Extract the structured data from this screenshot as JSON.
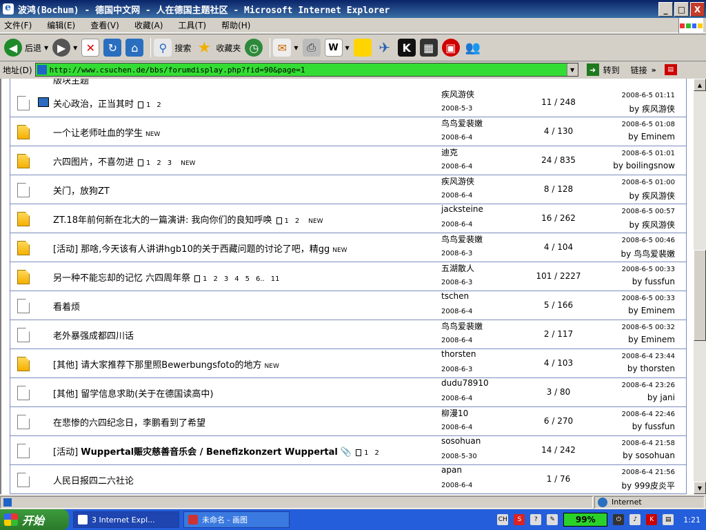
{
  "window": {
    "title": "波鸿(Bochum) - 德国中文网 - 人在德国主题社区 - Microsoft Internet Explorer",
    "btn_min": "_",
    "btn_max": "□",
    "btn_close": "X"
  },
  "menu": [
    "文件(F)",
    "编辑(E)",
    "查看(V)",
    "收藏(A)",
    "工具(T)",
    "帮助(H)"
  ],
  "toolbar": {
    "back": "后退",
    "search": "搜索",
    "favorites": "收藏夹"
  },
  "address": {
    "label": "地址(D)",
    "url": "http://www.csuchen.de/bbs/forumdisplay.php?fid=90&page=1",
    "go": "转到",
    "links": "链接",
    "chevron": "»"
  },
  "partial_row_text": "版块主题",
  "threads": [
    {
      "icon": "plain",
      "picture": true,
      "prefix": "",
      "title": "关心政治，正当其时",
      "bold": false,
      "pages": [
        "1",
        "2"
      ],
      "new": "",
      "author": "疾风游侠",
      "author_date": "2008-5-3",
      "stats": "11 / 248",
      "last_date": "2008-6-5 01:11",
      "last_by": "by 疾风游侠"
    },
    {
      "icon": "hot",
      "picture": false,
      "prefix": "",
      "title": "一个让老师吐血的学生",
      "bold": false,
      "pages": [],
      "new": "NEW",
      "author": "鸟鸟爱裴嫩",
      "author_date": "2008-6-4",
      "stats": "4 / 130",
      "last_date": "2008-6-5 01:08",
      "last_by": "by Eminem"
    },
    {
      "icon": "hot",
      "picture": false,
      "prefix": "",
      "title": "六四图片，不喜勿进",
      "bold": false,
      "pages": [
        "1",
        "2",
        "3"
      ],
      "new": "NEW",
      "author": "迪克",
      "author_date": "2008-6-4",
      "stats": "24 / 835",
      "last_date": "2008-6-5 01:01",
      "last_by": "by boilingsnow"
    },
    {
      "icon": "plain",
      "picture": false,
      "prefix": "",
      "title": "关门，放狗ZT",
      "bold": false,
      "pages": [],
      "new": "",
      "author": "疾风游侠",
      "author_date": "2008-6-4",
      "stats": "8 / 128",
      "last_date": "2008-6-5 01:00",
      "last_by": "by 疾风游侠"
    },
    {
      "icon": "hot",
      "picture": false,
      "prefix": "",
      "title": "ZT.18年前何新在北大的一篇演讲: 我向你们的良知呼唤",
      "bold": false,
      "pages": [
        "1",
        "2"
      ],
      "new": "NEW",
      "author": "jacksteine",
      "author_date": "2008-6-4",
      "stats": "16 / 262",
      "last_date": "2008-6-5 00:57",
      "last_by": "by 疾风游侠"
    },
    {
      "icon": "hot",
      "picture": false,
      "prefix": "[活动]",
      "title": "那啥,今天该有人讲讲hgb10的关于西藏问题的讨论了吧，精gg",
      "bold": false,
      "pages": [],
      "new": "NEW",
      "author": "鸟鸟爱裴嫩",
      "author_date": "2008-6-3",
      "stats": "4 / 104",
      "last_date": "2008-6-5 00:46",
      "last_by": "by 鸟鸟爱裴嫩"
    },
    {
      "icon": "hot",
      "picture": false,
      "prefix": "",
      "title": "另一种不能忘却的记忆 六四周年祭",
      "bold": false,
      "pages": [
        "1",
        "2",
        "3",
        "4",
        "5",
        "6..",
        "11"
      ],
      "new": "",
      "author": "五湖散人",
      "author_date": "2008-6-3",
      "stats": "101 / 2227",
      "last_date": "2008-6-5 00:33",
      "last_by": "by fussfun"
    },
    {
      "icon": "plain",
      "picture": false,
      "prefix": "",
      "title": "看着烦",
      "bold": false,
      "pages": [],
      "new": "",
      "author": "tschen",
      "author_date": "2008-6-4",
      "stats": "5 / 166",
      "last_date": "2008-6-5 00:33",
      "last_by": "by Eminem"
    },
    {
      "icon": "plain",
      "picture": false,
      "prefix": "",
      "title": "老外暴强成都四川话",
      "bold": false,
      "pages": [],
      "new": "",
      "author": "鸟鸟爱裴嫩",
      "author_date": "2008-6-4",
      "stats": "2 / 117",
      "last_date": "2008-6-5 00:32",
      "last_by": "by Eminem"
    },
    {
      "icon": "hot",
      "picture": false,
      "prefix": "[其他]",
      "title": "请大家推荐下那里照Bewerbungsfoto的地方",
      "bold": false,
      "pages": [],
      "new": "NEW",
      "author": "thorsten",
      "author_date": "2008-6-3",
      "stats": "4 / 103",
      "last_date": "2008-6-4 23:44",
      "last_by": "by thorsten"
    },
    {
      "icon": "plain",
      "picture": false,
      "prefix": "[其他]",
      "title": "留学信息求助(关于在德国读高中)",
      "bold": false,
      "pages": [],
      "new": "",
      "author": "dudu78910",
      "author_date": "2008-6-4",
      "stats": "3 / 80",
      "last_date": "2008-6-4 23:26",
      "last_by": "by jani"
    },
    {
      "icon": "plain",
      "picture": false,
      "prefix": "",
      "title": "在悲惨的六四纪念日，李鹏看到了希望",
      "bold": false,
      "pages": [],
      "new": "",
      "author": "柳漫10",
      "author_date": "2008-6-4",
      "stats": "6 / 270",
      "last_date": "2008-6-4 22:46",
      "last_by": "by fussfun"
    },
    {
      "icon": "plain",
      "picture": false,
      "prefix": "[活动]",
      "title": "Wuppertal赈灾慈善音乐会 / Benefizkonzert Wuppertal",
      "bold": true,
      "pages": [
        "1",
        "2"
      ],
      "new": "",
      "attach": true,
      "author": "sosohuan",
      "author_date": "2008-5-30",
      "stats": "14 / 242",
      "last_date": "2008-6-4 21:58",
      "last_by": "by sosohuan"
    },
    {
      "icon": "plain",
      "picture": false,
      "prefix": "",
      "title": "人民日报四二六社论",
      "bold": false,
      "pages": [],
      "new": "",
      "author": "apan",
      "author_date": "2008-6-4",
      "stats": "1 / 76",
      "last_date": "2008-6-4 21:56",
      "last_by": "by 999皮炎平"
    }
  ],
  "status": {
    "zone": "Internet"
  },
  "taskbar": {
    "start": "开始",
    "tasks": [
      {
        "label": "3 Internet Expl..."
      },
      {
        "label": "未命名 - 画图"
      }
    ],
    "battery": "99%",
    "clock": "1:21",
    "tray_lang": "CH",
    "tray_s": "S",
    "tray_q": "?"
  },
  "colors": {
    "address_bg": "#33dd33",
    "title_bg": "#0a246a",
    "row_border": "#7b8cbd",
    "hot_icon": "#f5b000"
  }
}
